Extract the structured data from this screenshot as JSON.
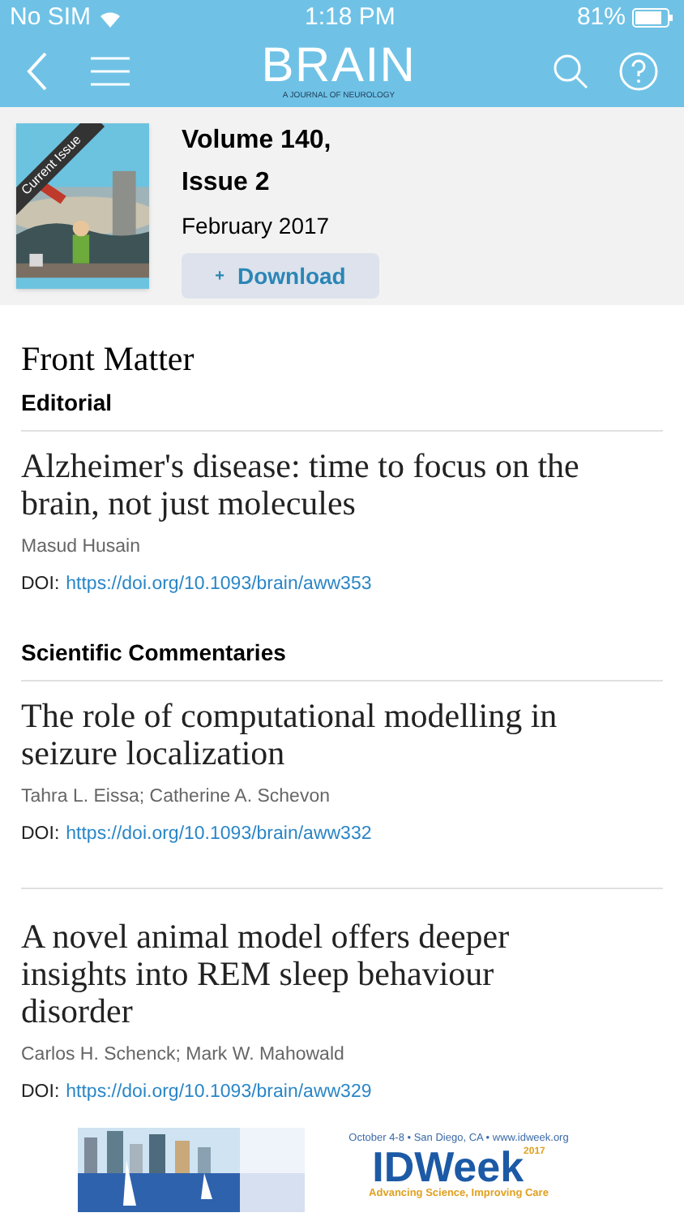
{
  "status_bar": {
    "carrier": "No SIM",
    "time": "1:18 PM",
    "battery": "81%"
  },
  "header": {
    "logo": "BRAIN",
    "tagline": "A JOURNAL OF NEUROLOGY"
  },
  "issue": {
    "ribbon": "Current Issue",
    "volume": "Volume 140,",
    "number": "Issue 2",
    "date": "February 2017",
    "download": "Download",
    "download_icon": "+"
  },
  "heading": "Front Matter",
  "sections": [
    {
      "title": "Editorial",
      "articles": [
        {
          "title": "Alzheimer's disease: time to focus on the brain, not just molecules",
          "authors": "Masud Husain",
          "doi_label": "DOI:",
          "doi": "https://doi.org/10.1093/brain/aww353"
        }
      ]
    },
    {
      "title": "Scientific Commentaries",
      "articles": [
        {
          "title": "The role of computational modelling in seizure localization",
          "authors": "Tahra L. Eissa; Catherine A. Schevon",
          "doi_label": "DOI:",
          "doi": "https://doi.org/10.1093/brain/aww332"
        },
        {
          "title": "A novel animal model offers deeper insights into REM sleep behaviour disorder",
          "authors": "Carlos H. Schenck; Mark W. Mahowald",
          "doi_label": "DOI:",
          "doi": "https://doi.org/10.1093/brain/aww329"
        }
      ]
    }
  ],
  "ad": {
    "line": "October 4-8 • San Diego, CA • www.idweek.org",
    "brand": "IDWeek",
    "year": "2017",
    "slogan": "Advancing Science, Improving Care"
  }
}
